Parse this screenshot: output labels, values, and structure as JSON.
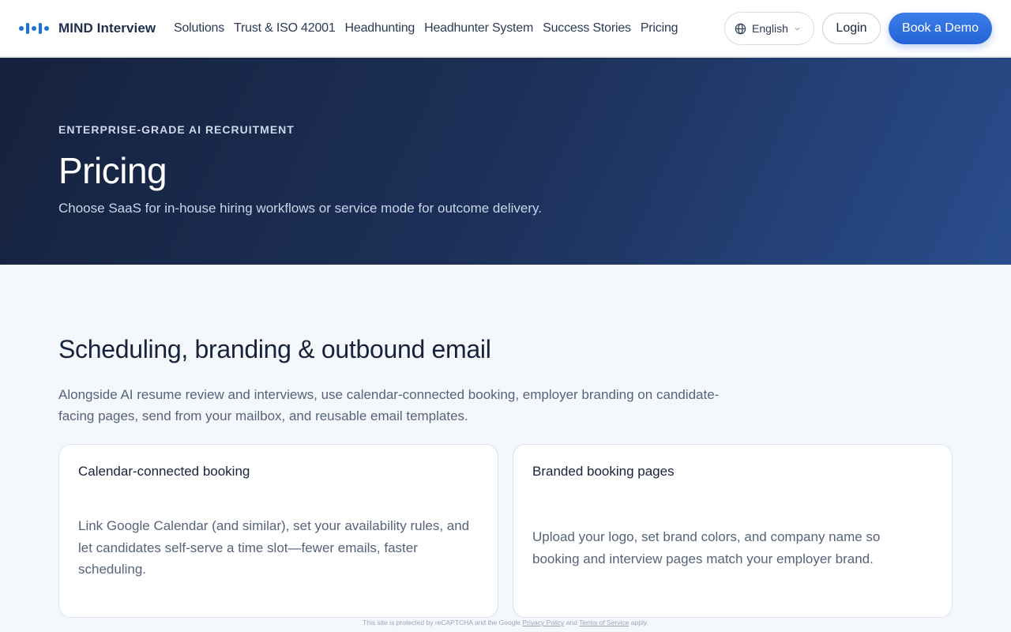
{
  "header": {
    "brand": "MIND Interview",
    "nav": [
      "Solutions",
      "Trust & ISO 42001",
      "Headhunting",
      "Headhunter System",
      "Success Stories",
      "Pricing"
    ],
    "language": "English",
    "login": "Login",
    "book_demo": "Book a Demo"
  },
  "hero": {
    "eyebrow": "ENTERPRISE-GRADE AI RECRUITMENT",
    "title": "Pricing",
    "subtitle": "Choose SaaS for in-house hiring workflows or service mode for outcome delivery."
  },
  "section": {
    "title": "Scheduling, branding & outbound email",
    "description": "Alongside AI resume review and interviews, use calendar-connected booking, employer branding on candidate-facing pages, send from your mailbox, and reusable email templates.",
    "cards": [
      {
        "title": "Calendar-connected booking",
        "body": "Link Google Calendar (and similar), set your availability rules, and let candidates self-serve a time slot—fewer emails, faster scheduling."
      },
      {
        "title": "Branded booking pages",
        "body": "Upload your logo, set brand colors, and company name so booking and interview pages match your employer brand."
      }
    ]
  },
  "recaptcha": {
    "prefix": "This site is protected by reCAPTCHA and the Google",
    "privacy": "Privacy Policy",
    "and": "and",
    "terms": "Terms of Service",
    "suffix": "apply."
  },
  "colors": {
    "accent": "#2563d6",
    "logo_blue": "#1f6fd8",
    "hero_dark": "#15223e",
    "hero_light": "#2a4d8d"
  },
  "icons": {
    "brand": "mind-logo-icon",
    "language": "globe-icon",
    "dropdown": "chevron-down-icon"
  }
}
